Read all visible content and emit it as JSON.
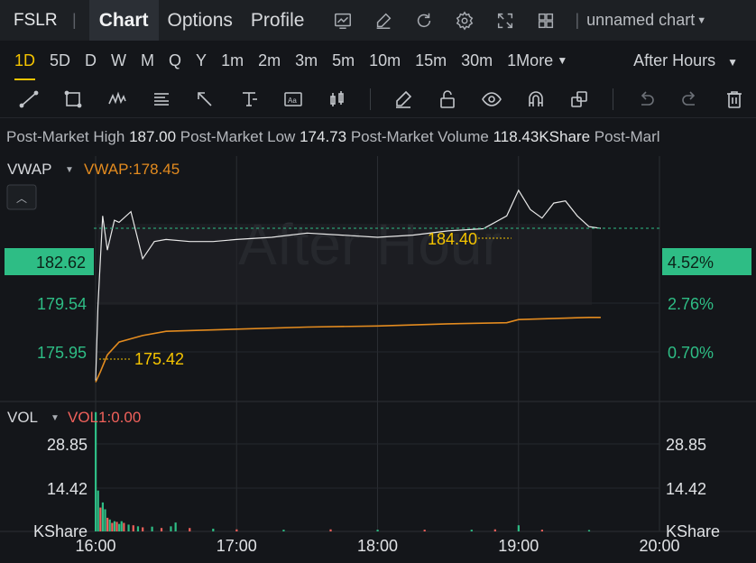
{
  "topbar": {
    "symbol": "FSLR",
    "tabs": [
      "Chart",
      "Options",
      "Profile"
    ],
    "chart_name": "unnamed chart"
  },
  "intervals": {
    "items": [
      "1D",
      "5D",
      "D",
      "W",
      "M",
      "Q",
      "Y",
      "1m",
      "2m",
      "3m",
      "5m",
      "10m",
      "15m",
      "30m",
      "1More"
    ],
    "active": "1D",
    "session": "After Hours"
  },
  "info": {
    "high_label": "Post-Market High",
    "high": "187.00",
    "low_label": "Post-Market Low",
    "low": "174.73",
    "volume_label": "Post-Market Volume",
    "volume": "118.43KShare",
    "truncated_label": "Post-Marl"
  },
  "main_pane": {
    "indicator_label": "VWAP",
    "indicator_value": "VWAP:178.45",
    "watermark": "After Hour",
    "current_price": "182.62",
    "current_pct": "4.52%",
    "left_ticks": [
      "179.54",
      "175.95"
    ],
    "right_ticks": [
      "2.76%",
      "0.70%"
    ],
    "max_annotation": "184.40",
    "min_annotation": "175.42"
  },
  "vol_pane": {
    "indicator_label": "VOL",
    "indicator_value": "VOL1:0.00",
    "ticks": [
      "28.85",
      "14.42"
    ],
    "unit": "KShare"
  },
  "x_axis": [
    "16:00",
    "17:00",
    "18:00",
    "19:00",
    "20:00"
  ],
  "colors": {
    "accent": "#f5c400",
    "up": "#2ebd85",
    "down": "#f0615b",
    "vwap": "#e38b1f",
    "price_line": "#e8e8e8",
    "price_badge": "#2ebd85"
  },
  "chart_data": {
    "type": "line",
    "x_range": [
      "16:00",
      "20:00"
    ],
    "price": {
      "x": [
        "16:00",
        "16:01",
        "16:03",
        "16:05",
        "16:08",
        "16:10",
        "16:15",
        "16:20",
        "16:25",
        "16:30",
        "16:40",
        "16:50",
        "17:00",
        "17:15",
        "17:30",
        "17:45",
        "18:00",
        "18:15",
        "18:30",
        "18:45",
        "18:55",
        "19:00",
        "19:05",
        "19:10",
        "19:15",
        "19:20",
        "19:25",
        "19:30",
        "19:35"
      ],
      "values": [
        175.5,
        179.0,
        183.2,
        181.6,
        183.0,
        182.9,
        183.4,
        181.2,
        182.0,
        182.1,
        182.0,
        182.0,
        182.1,
        182.2,
        182.4,
        182.3,
        182.2,
        182.3,
        182.5,
        182.6,
        183.2,
        184.4,
        183.5,
        183.1,
        183.8,
        183.9,
        183.2,
        182.7,
        182.62
      ]
    },
    "vwap": {
      "x": [
        "16:00",
        "16:02",
        "16:05",
        "16:10",
        "16:20",
        "16:30",
        "17:00",
        "17:30",
        "18:00",
        "18:30",
        "18:55",
        "19:00",
        "19:30",
        "19:35"
      ],
      "values": [
        175.42,
        175.9,
        176.7,
        177.3,
        177.6,
        177.8,
        177.9,
        178.0,
        178.05,
        178.15,
        178.2,
        178.35,
        178.45,
        178.45
      ]
    },
    "volume": {
      "x": [
        "16:00",
        "16:01",
        "16:02",
        "16:03",
        "16:04",
        "16:05",
        "16:06",
        "16:07",
        "16:08",
        "16:09",
        "16:10",
        "16:11",
        "16:12",
        "16:14",
        "16:16",
        "16:18",
        "16:20",
        "16:24",
        "16:28",
        "16:32",
        "16:34",
        "16:40",
        "16:50",
        "17:00",
        "17:20",
        "17:40",
        "18:00",
        "18:20",
        "18:40",
        "18:50",
        "19:00",
        "19:10",
        "19:30"
      ],
      "values": [
        35.0,
        12.0,
        7.0,
        8.5,
        6.5,
        4.0,
        3.5,
        2.5,
        3.0,
        2.8,
        2.2,
        3.0,
        2.5,
        2.0,
        1.8,
        1.5,
        1.2,
        1.4,
        1.0,
        1.5,
        2.6,
        1.0,
        0.8,
        0.6,
        0.5,
        0.6,
        0.5,
        0.5,
        0.5,
        0.6,
        1.8,
        0.5,
        0.4
      ],
      "up": [
        true,
        true,
        false,
        true,
        true,
        false,
        true,
        false,
        true,
        false,
        true,
        true,
        false,
        true,
        false,
        true,
        false,
        true,
        false,
        true,
        true,
        false,
        true,
        false,
        true,
        false,
        true,
        false,
        true,
        false,
        true,
        false,
        true
      ]
    },
    "price_axis": {
      "ymin": 174.6,
      "ymax": 186.0
    },
    "volume_axis": {
      "ymax": 36.0
    }
  }
}
